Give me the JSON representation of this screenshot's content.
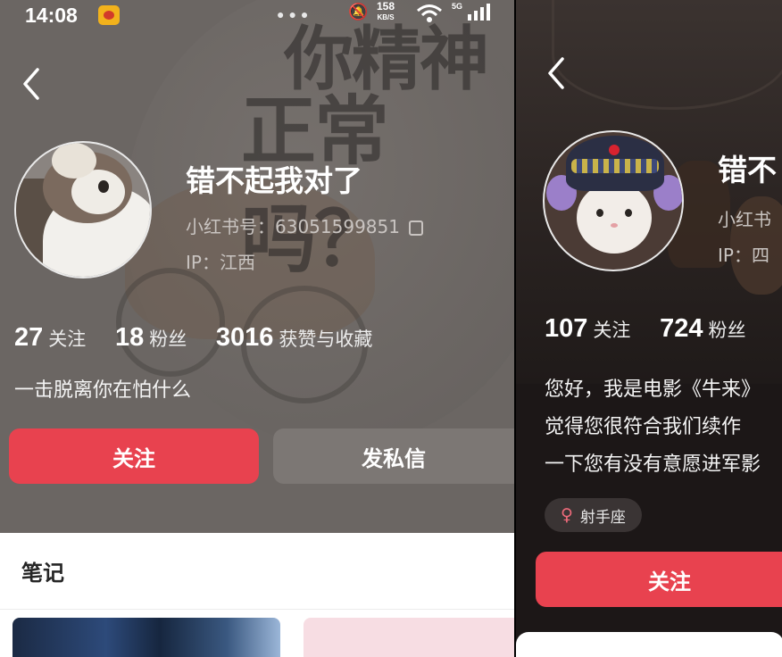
{
  "left": {
    "status": {
      "time": "14:08",
      "net_speed": "158",
      "net_unit": "KB/S",
      "signal": "5G"
    },
    "bg_text": [
      "你精神",
      "正常吗？"
    ],
    "profile": {
      "name": "错不起我对了",
      "red_id": "小红书号：63051599851",
      "ip": "IP：江西",
      "stats": [
        {
          "value": "27",
          "label": "关注"
        },
        {
          "value": "18",
          "label": "粉丝"
        },
        {
          "value": "3016",
          "label": "获赞与收藏"
        }
      ],
      "bio": "一击脱离你在怕什么"
    },
    "buttons": {
      "follow": "关注",
      "message": "发私信"
    },
    "notes_tab": "笔记"
  },
  "right": {
    "profile": {
      "name": "错不",
      "red_id": "小红书",
      "ip": "IP：四",
      "stats": [
        {
          "value": "107",
          "label": "关注"
        },
        {
          "value": "724",
          "label": "粉丝"
        }
      ],
      "bio_lines": [
        "您好，我是电影《牛来》",
        "觉得您很符合我们续作 ",
        "一下您有没有意愿进军影"
      ],
      "tag": "射手座",
      "gender_symbol": "♀"
    },
    "buttons": {
      "follow": "关注"
    }
  },
  "colors": {
    "accent": "#e8424f",
    "left_bg": "#6b6663",
    "right_bg": "#1c1717"
  }
}
